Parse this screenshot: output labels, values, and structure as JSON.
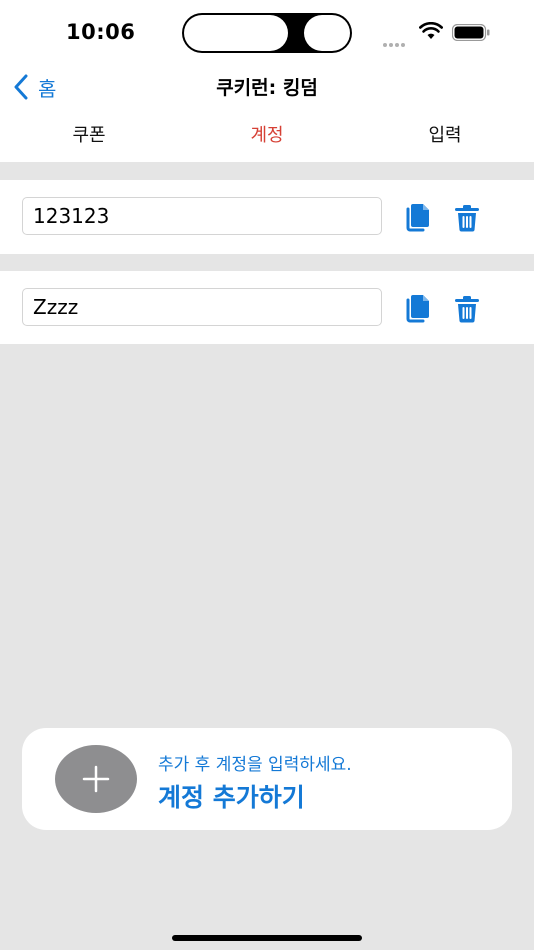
{
  "status_bar": {
    "time": "10:06"
  },
  "nav": {
    "back_label": "홈",
    "title": "쿠키런: 킹덤"
  },
  "tabs": [
    {
      "label": "쿠폰",
      "active": false
    },
    {
      "label": "계정",
      "active": true
    },
    {
      "label": "입력",
      "active": false
    }
  ],
  "accounts": [
    {
      "value": "123123"
    },
    {
      "value": "Zzzz"
    }
  ],
  "add_card": {
    "hint": "추가 후 계정을 입력하세요.",
    "label": "계정 추가하기"
  },
  "colors": {
    "accent": "#1479d6",
    "active_tab": "#d64035",
    "background": "#e5e5e5"
  }
}
